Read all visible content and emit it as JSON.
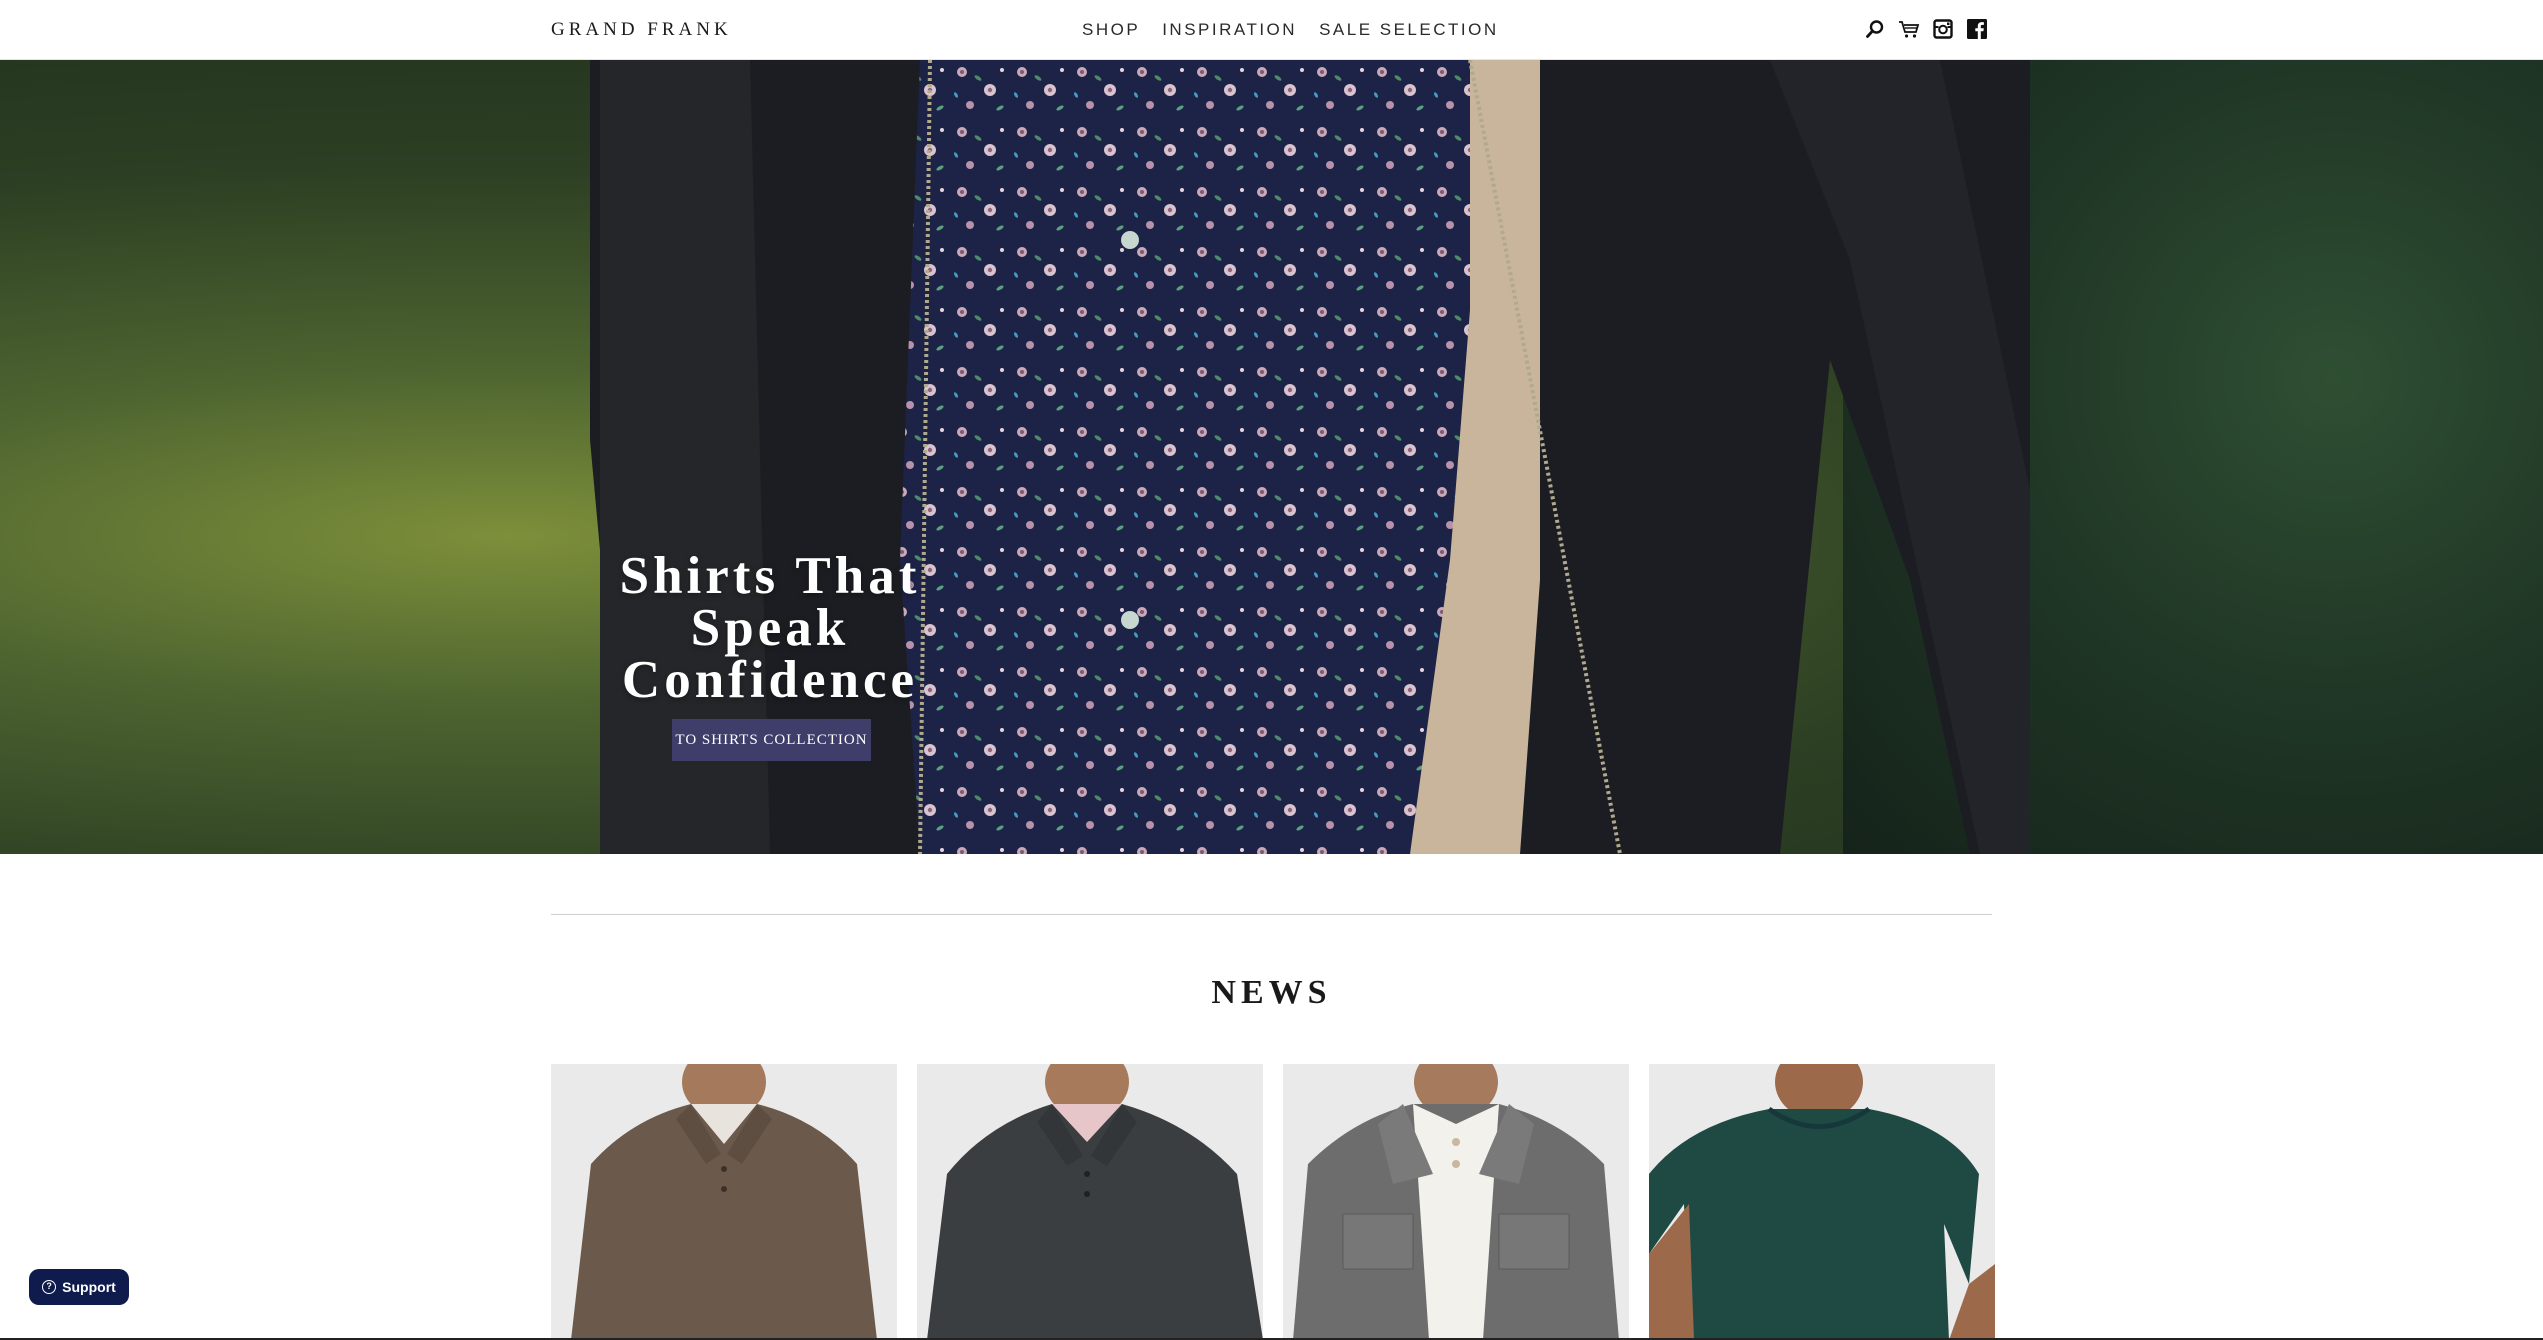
{
  "header": {
    "logo": "GRAND FRANK",
    "nav": [
      "SHOP",
      "INSPIRATION",
      "SALE SELECTION"
    ],
    "icons": [
      "search-icon",
      "cart-icon",
      "instagram-icon",
      "facebook-icon"
    ]
  },
  "hero": {
    "title_bold_1": "Shirts",
    "title_rest_1": " That",
    "title_line_2": "Speak",
    "title_line_3": "Confidence",
    "cta_label": "TO SHIRTS COLLECTION",
    "cta_color": "#3f3e6a"
  },
  "news": {
    "title": "NEWS",
    "items": [
      {
        "color": "#6b5a4c"
      },
      {
        "color": "#3b3e40"
      },
      {
        "color": "#6d6d6d"
      },
      {
        "color": "#1f4a44"
      }
    ]
  },
  "support": {
    "label": "Support",
    "color": "#0f1b4c"
  }
}
